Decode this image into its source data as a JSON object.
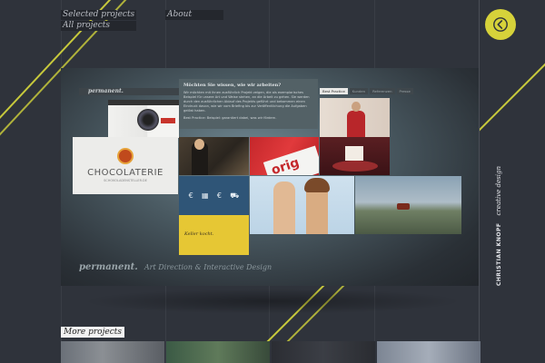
{
  "nav": {
    "selected_projects": "Selected projects",
    "all_projects": "All projects",
    "about": "About"
  },
  "back_button": {
    "icon": "chevron-left-icon",
    "color": "#d6d23a"
  },
  "sidebar_brand": {
    "name": "CHRISTIAN KNOPF",
    "tagline": "creative design"
  },
  "stage": {
    "mini_brand": "permanent.",
    "info_heading": "Möchten Sie wissen, wie wir arbeiten?",
    "info_body": "Wir möchten mit ihnen ausführlich Projekt zeigen, die als exemplarisches Beispiel für unsere Art und Weise stehen, an die Arbeit zu gehen. Sie werden durch den ausführlichen Ablauf des Projekts geführt und bekommen einen Eindruck davon, wie wir vom Briefing bis zur Veröffentlichung die Aufgaben gelöst haben.",
    "info_foot": "Best Practice: Beispiel: garantiert dabei, was wir fördern.",
    "tabs": [
      "Best Practice",
      "Kunden",
      "Referenzen",
      "Presse"
    ],
    "choc_word": "CHOCOLATERIE",
    "choc_sub": "SCHOKOLADENSTELLER.DE",
    "red_card_text": "orig",
    "yellow_text": "Keller kocht.",
    "icons": [
      "€",
      "▦",
      "€",
      "⛟"
    ],
    "footer_brand": "permanent.",
    "footer_desc": "Art Direction & Interactive Design"
  },
  "more": {
    "label": "More projects"
  },
  "colors": {
    "accent": "#d6d23a",
    "background": "#2f333b"
  }
}
